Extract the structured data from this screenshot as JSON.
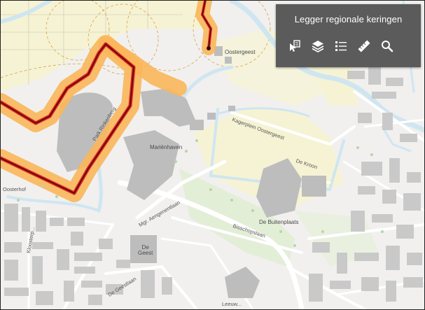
{
  "panel": {
    "title": "Legger regionale keringen",
    "tools": [
      {
        "icon": "select-pointer-icon",
        "label": ""
      },
      {
        "icon": "layers-icon",
        "label": ""
      },
      {
        "icon": "legend-list-icon",
        "label": ""
      },
      {
        "icon": "measure-ruler-icon",
        "label": ""
      },
      {
        "icon": "search-icon",
        "label": ""
      }
    ]
  },
  "map": {
    "colors": {
      "land": "#f1f0ee",
      "water": "#cfe6f1",
      "building": "#c6c6c6",
      "greenfield": "#e3eed7",
      "yellowfield": "#f6f3d4",
      "dike_halo": "#f9b65a",
      "dike_line": "#e01c1c",
      "dike_core": "#2a0f0f"
    },
    "place_labels": {
      "oostergeest": "Oostergeest",
      "marienhaven": "Mariënhaven",
      "de_geest": "De\nGeest",
      "de_buitenplaats": "De Buitenplaats"
    },
    "street_labels": {
      "park_rinkenberg": "Park Rinkenberg",
      "kagerplein": "Kagerplein Oostergeest",
      "de_kroon": "De Kroon",
      "mgr_aengenentlaan": "Mgr. Aengenentlaan",
      "bisschopslaan": "Bisschopslaan",
      "de_geestlaan": "De Geestlaan",
      "oosterhof": "Oosterhof",
      "klooster": "Kloosterp...",
      "leeuw": "Leeuw..."
    }
  }
}
